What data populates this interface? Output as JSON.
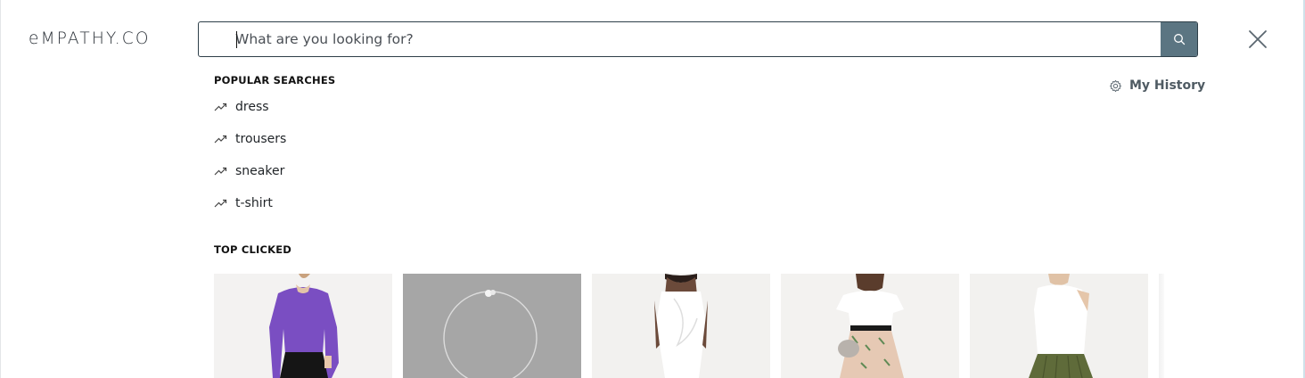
{
  "brand": {
    "logo_text": "eMPATHY.CO"
  },
  "search": {
    "placeholder": "What are you looking for?",
    "value": "",
    "button_icon": "search-icon"
  },
  "close": {
    "icon": "close-icon"
  },
  "popular_searches": {
    "title": "POPULAR SEARCHES",
    "icon": "trending-icon",
    "items": [
      "dress",
      "trousers",
      "sneaker",
      "t-shirt"
    ]
  },
  "history": {
    "label": "My History",
    "icon": "gear-icon"
  },
  "top_clicked": {
    "title": "TOP CLICKED",
    "products": [
      {
        "image": "purple-knit-sweater"
      },
      {
        "image": "silver-necklace"
      },
      {
        "image": "white-ruffle-jumpsuit"
      },
      {
        "image": "floral-pleated-skirt-outfit"
      },
      {
        "image": "white-top-olive-skirt"
      }
    ]
  },
  "colors": {
    "search_button": "#5b7582",
    "border": "#2e3f49",
    "text_muted": "#4f5b63"
  }
}
